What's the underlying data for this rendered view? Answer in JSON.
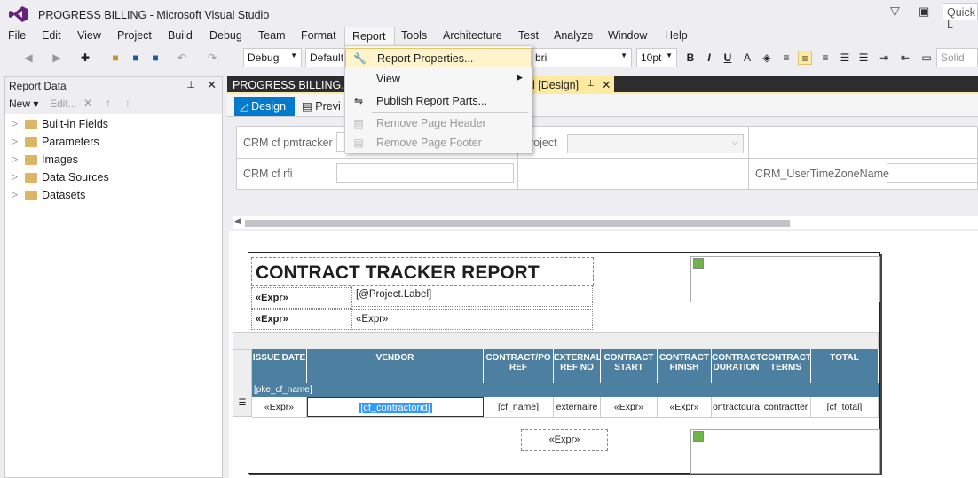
{
  "window": {
    "title": "PROGRESS BILLING - Microsoft Visual Studio",
    "quick_launch": "Quick L"
  },
  "menubar": [
    "File",
    "Edit",
    "View",
    "Project",
    "Build",
    "Debug",
    "Team",
    "Format",
    "Report",
    "Tools",
    "Architecture",
    "Test",
    "Analyze",
    "Window",
    "Help"
  ],
  "toolbar": {
    "config": "Debug",
    "platform": "Default",
    "font": "bri",
    "size": "10pt",
    "solid": "Solid"
  },
  "report_menu": {
    "items": [
      {
        "label": "Report Properties...",
        "icon": "wrench-icon",
        "enabled": true
      },
      {
        "label": "View",
        "icon": "",
        "enabled": true,
        "submenu": true
      },
      {
        "label": "Publish Report Parts...",
        "icon": "publish-icon",
        "enabled": true
      },
      {
        "label": "Remove Page Header",
        "icon": "page-header-icon",
        "enabled": false
      },
      {
        "label": "Remove Page Footer",
        "icon": "page-footer-icon",
        "enabled": false
      }
    ]
  },
  "report_data": {
    "title": "Report Data",
    "new": "New",
    "edit": "Edit...",
    "tree": [
      "Built-in Fields",
      "Parameters",
      "Images",
      "Data Sources",
      "Datasets"
    ]
  },
  "doc_tabs": {
    "tab1": "PROGRESS BILLING.rdl [",
    "tab2": "l [Design]"
  },
  "design_tabs": {
    "design": "Design",
    "preview": "Previ"
  },
  "params": {
    "p1": "CRM cf pmtracker",
    "p2": "CRM cf rfi",
    "p3": "roject",
    "p4": "CRM_UserTimeZoneName"
  },
  "report": {
    "title": "CONTRACT TRACKER REPORT",
    "expr": "«Expr»",
    "project_label": "[@Project.Label]",
    "group_field": "[pke_cf_name]",
    "headers": [
      "ISSUE DATE",
      "VENDOR",
      "CONTRACT/PO REF",
      "EXTERNAL REF NO",
      "CONTRACT START",
      "CONTRACT FINISH",
      "CONTRACT DURATION",
      "CONTRACT TERMS",
      "TOTAL"
    ],
    "row": [
      "«Expr»",
      "[cf_contractorid]",
      "[cf_name]",
      "externalre",
      "«Expr»",
      "«Expr»",
      "ontractdura",
      "contractter",
      "[cf_total]"
    ],
    "footer_expr": "«Expr»"
  }
}
